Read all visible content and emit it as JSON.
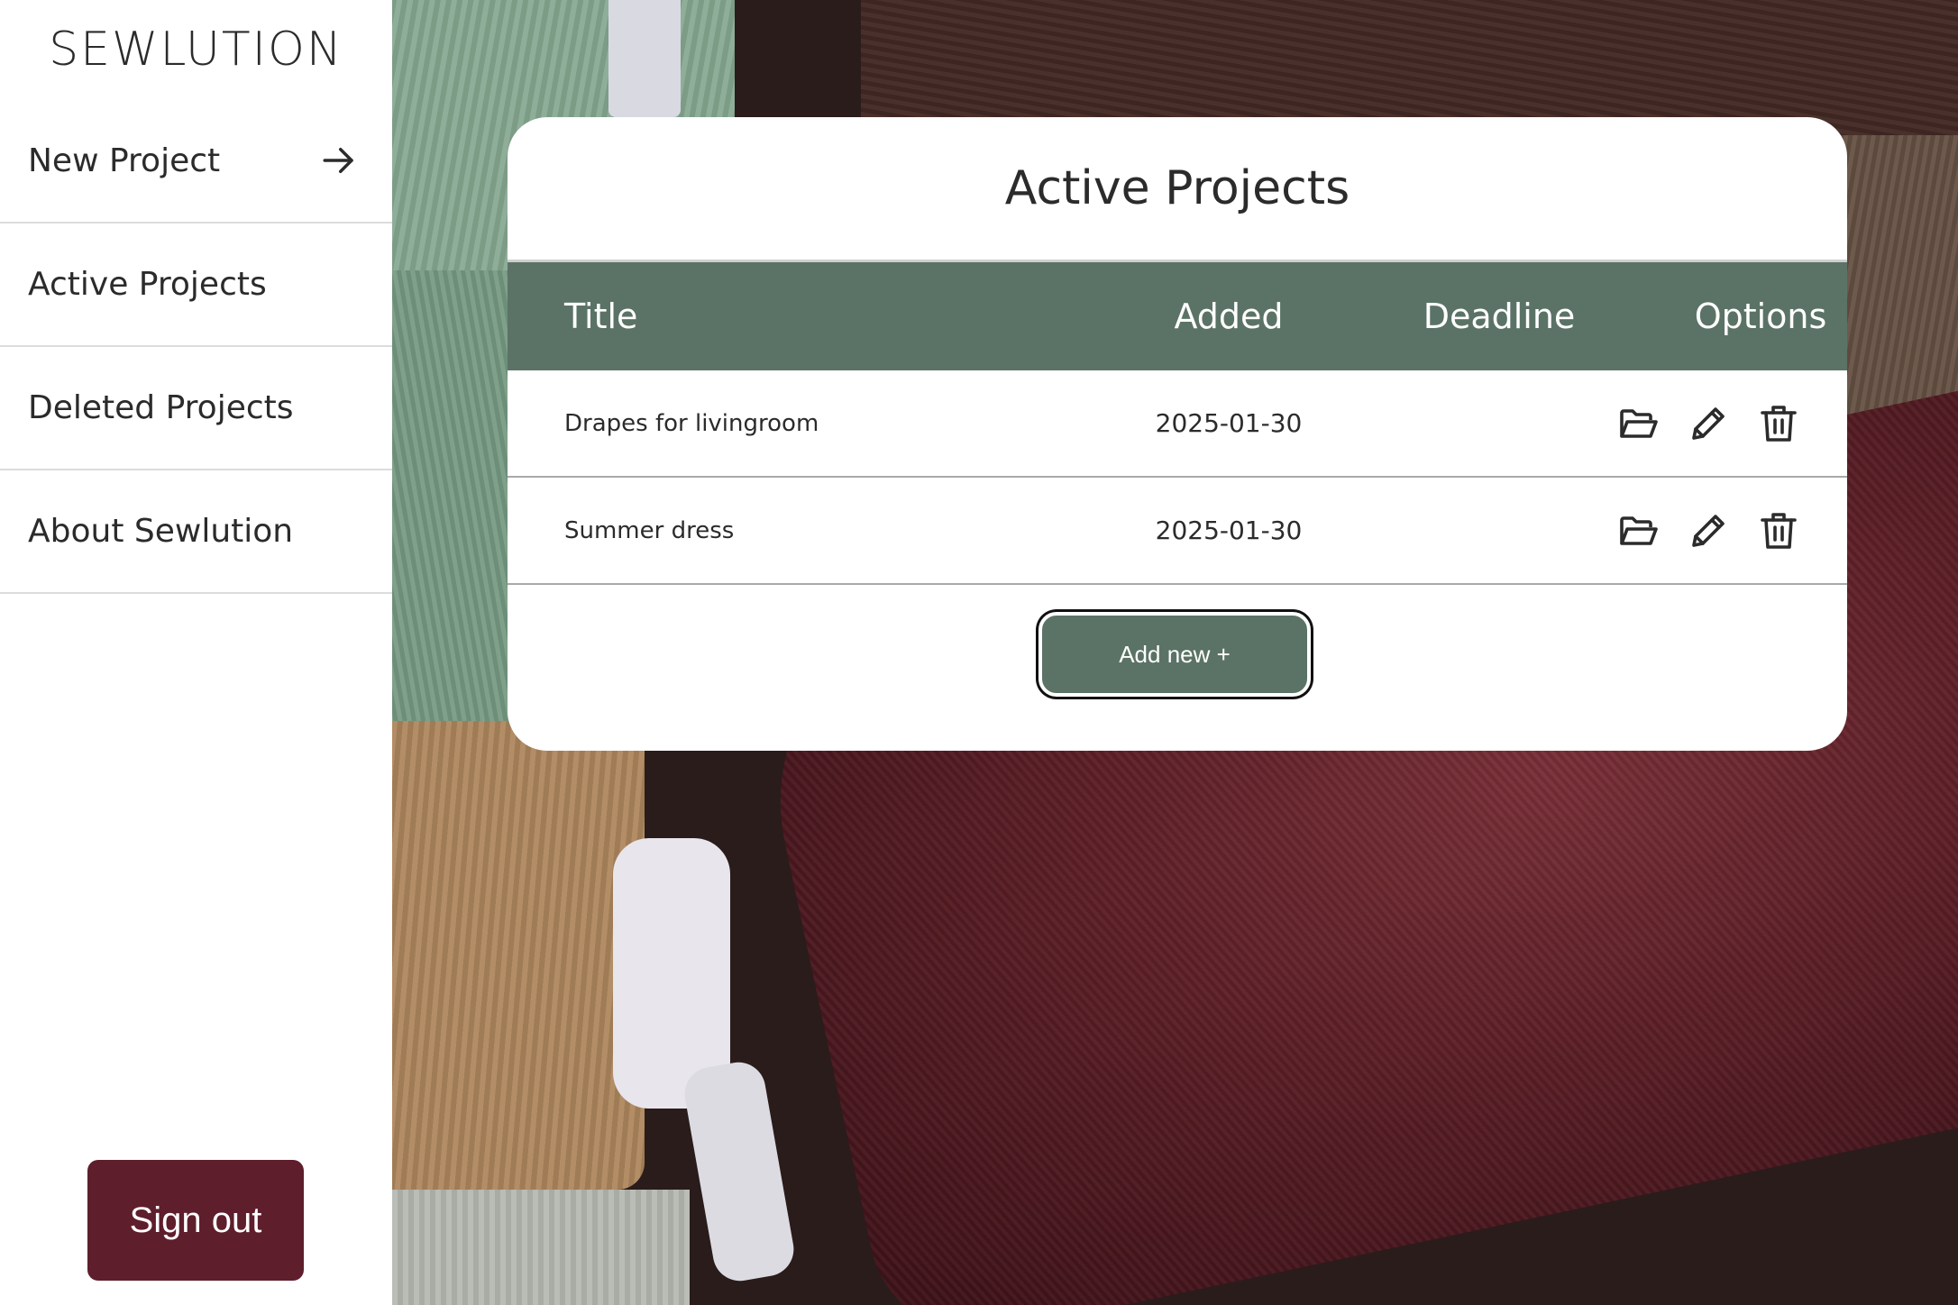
{
  "brand": "SEWLUTION",
  "sidebar": {
    "items": [
      {
        "label": "New Project",
        "icon": "arrow-right-icon"
      },
      {
        "label": "Active Projects"
      },
      {
        "label": "Deleted Projects"
      },
      {
        "label": "About Sewlution"
      }
    ],
    "signout_label": "Sign out"
  },
  "main": {
    "title": "Active Projects",
    "table": {
      "headers": [
        "Title",
        "Added",
        "Deadline",
        "Options"
      ],
      "rows": [
        {
          "title": "Drapes for livingroom",
          "added": "2025-01-30",
          "deadline": ""
        },
        {
          "title": "Summer dress",
          "added": "2025-01-30",
          "deadline": ""
        }
      ],
      "row_icons": [
        "folder-open-icon",
        "pencil-icon",
        "trash-icon"
      ]
    },
    "add_label": "Add new +"
  },
  "colors": {
    "accent": "#5b7366",
    "signout": "#5e1e2c"
  }
}
